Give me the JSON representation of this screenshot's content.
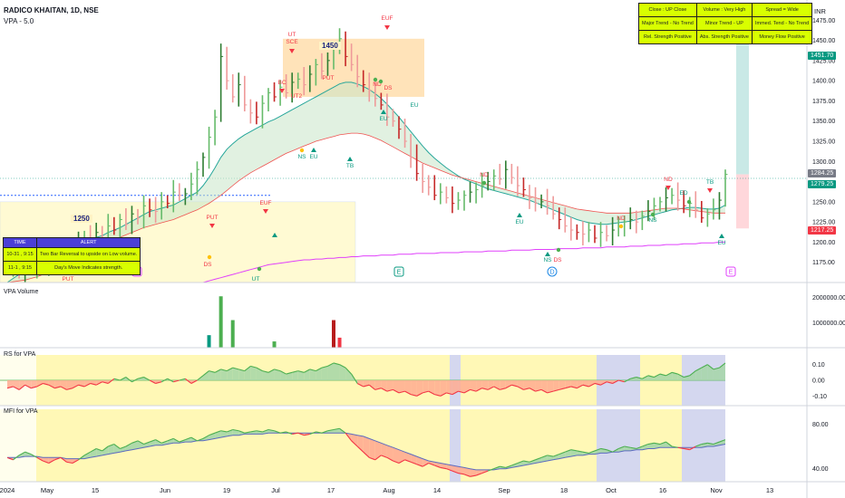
{
  "header": {
    "title": "RADICO KHAITAN, 1D, NSE",
    "indicator": "VPA - 5.0",
    "currency": "INR"
  },
  "trend_table": [
    [
      "Close : UP Close",
      "Volume : Very High",
      "Spread = Wide"
    ],
    [
      "Major Trend - No Trend",
      "Minor Trend - UP",
      "Immed. Tend - No Trend"
    ],
    [
      "Rel. Strength Positive",
      "Abs. Strength Positive",
      "Money Flow Positive"
    ]
  ],
  "alert_table": {
    "headers": [
      "TIME",
      "ALERT"
    ],
    "rows": [
      [
        "10-31 , 9:15",
        "Two Bar Reversal to upside on Low volume."
      ],
      [
        "11-1 , 9:15",
        "Day's Move Indicates strength."
      ]
    ]
  },
  "panes": {
    "volume": "VPA Volume",
    "rs": "RS for VPA",
    "mfi": "MFI for VPA"
  },
  "level_labels": [
    "1450",
    "1250"
  ],
  "price_tags": [
    {
      "value": "1451.70",
      "color": "#089981"
    },
    {
      "value": "1284.25",
      "color": "#787b86"
    },
    {
      "value": "1279.25",
      "color": "#089981"
    },
    {
      "value": "1217.25",
      "color": "#f23645"
    }
  ],
  "event_marks": [
    "E",
    "E",
    "D",
    "E"
  ],
  "annotations": [
    {
      "text": "EUF",
      "color": "#f23645"
    },
    {
      "text": "UT",
      "color": "#f23645"
    },
    {
      "text": "SCE",
      "color": "#f23645"
    },
    {
      "text": "BC",
      "color": "#f23645"
    },
    {
      "text": "UT2",
      "color": "#f23645"
    },
    {
      "text": "PUT",
      "color": "#f23645"
    },
    {
      "text": "ND",
      "color": "#f23645"
    },
    {
      "text": "DS",
      "color": "#f23645"
    },
    {
      "text": "EU",
      "color": "#089981"
    },
    {
      "text": "NS",
      "color": "#089981"
    },
    {
      "text": "EU",
      "color": "#089981"
    },
    {
      "text": "TB",
      "color": "#089981"
    },
    {
      "text": "EUF",
      "color": "#f23645"
    },
    {
      "text": "PUT",
      "color": "#f23645"
    },
    {
      "text": "DS",
      "color": "#f23645"
    },
    {
      "text": "UT",
      "color": "#089981"
    },
    {
      "text": "EU",
      "color": "#089981"
    },
    {
      "text": "ND",
      "color": "#f23645"
    },
    {
      "text": "EU",
      "color": "#089981"
    },
    {
      "text": "NS",
      "color": "#089981"
    },
    {
      "text": "DS",
      "color": "#f23645"
    },
    {
      "text": "ND",
      "color": "#f23645"
    },
    {
      "text": "NS",
      "color": "#089981"
    },
    {
      "text": "ND",
      "color": "#f23645"
    },
    {
      "text": "ED",
      "color": "#089981"
    },
    {
      "text": "TB",
      "color": "#089981"
    },
    {
      "text": "EU",
      "color": "#089981"
    },
    {
      "text": "PUT",
      "color": "#f23645"
    }
  ],
  "chart_data": [
    {
      "type": "candlestick",
      "title": "RADICO KHAITAN, 1D, NSE",
      "y_ticks": [
        1475,
        1450,
        1425,
        1400,
        1375,
        1350,
        1325,
        1300,
        1250,
        1225,
        1200,
        1175
      ],
      "y_tick_labels": [
        "1475.00",
        "1450.00",
        "1425.00",
        "1400.00",
        "1375.00",
        "1350.00",
        "1325.00",
        "1300.00",
        "1250.00",
        "1225.00",
        "1200.00",
        "1175.00"
      ],
      "ylim": [
        1150,
        1500
      ],
      "x_tick_labels": [
        "2024",
        "May",
        "15",
        "Jun",
        "19",
        "Jul",
        "17",
        "Aug",
        "14",
        "Sep",
        "18",
        "Oct",
        "16",
        "Nov",
        "13"
      ],
      "closes": [
        1168,
        1172,
        1162,
        1175,
        1168,
        1180,
        1172,
        1185,
        1190,
        1182,
        1195,
        1188,
        1200,
        1205,
        1198,
        1212,
        1205,
        1220,
        1215,
        1228,
        1222,
        1235,
        1230,
        1245,
        1240,
        1238,
        1250,
        1248,
        1262,
        1258,
        1260,
        1272,
        1290,
        1305,
        1330,
        1355,
        1430,
        1400,
        1380,
        1395,
        1370,
        1360,
        1355,
        1372,
        1385,
        1380,
        1392,
        1385,
        1398,
        1402,
        1395,
        1408,
        1420,
        1412,
        1425,
        1440,
        1452,
        1430,
        1420,
        1405,
        1395,
        1388,
        1378,
        1370,
        1355,
        1350,
        1340,
        1325,
        1305,
        1285,
        1275,
        1268,
        1258,
        1262,
        1255,
        1248,
        1252,
        1258,
        1262,
        1265,
        1270,
        1275,
        1282,
        1278,
        1290,
        1280,
        1270,
        1265,
        1255,
        1248,
        1250,
        1245,
        1235,
        1228,
        1220,
        1215,
        1212,
        1210,
        1215,
        1205,
        1212,
        1208,
        1215,
        1220,
        1225,
        1228,
        1225,
        1232,
        1238,
        1245,
        1250,
        1255,
        1258,
        1252,
        1245,
        1248,
        1240,
        1230,
        1235,
        1240,
        1252,
        1284
      ],
      "ema_fast": [
        1150,
        1155,
        1160,
        1165,
        1170,
        1172,
        1175,
        1180,
        1185,
        1188,
        1190,
        1193,
        1196,
        1200,
        1203,
        1206,
        1208,
        1212,
        1215,
        1218,
        1222,
        1226,
        1230,
        1234,
        1238,
        1240,
        1242,
        1244,
        1246,
        1250,
        1254,
        1258,
        1262,
        1270,
        1280,
        1292,
        1305,
        1315,
        1322,
        1328,
        1333,
        1337,
        1341,
        1345,
        1349,
        1352,
        1356,
        1360,
        1364,
        1368,
        1372,
        1376,
        1380,
        1384,
        1388,
        1392,
        1396,
        1398,
        1398,
        1396,
        1393,
        1389,
        1384,
        1378,
        1371,
        1363,
        1355,
        1346,
        1337,
        1328,
        1319,
        1311,
        1304,
        1298,
        1292,
        1287,
        1282,
        1278,
        1275,
        1272,
        1269,
        1266,
        1264,
        1262,
        1260,
        1258,
        1256,
        1254,
        1252,
        1249,
        1246,
        1243,
        1240,
        1237,
        1234,
        1231,
        1228,
        1226,
        1224,
        1223,
        1222,
        1222,
        1223,
        1224,
        1225,
        1226,
        1228,
        1230,
        1232,
        1234,
        1236,
        1238,
        1240,
        1241,
        1242,
        1243,
        1243,
        1242,
        1241,
        1241,
        1242,
        1246
      ],
      "ema_slow": [
        1150,
        1151,
        1152,
        1153,
        1155,
        1157,
        1160,
        1163,
        1166,
        1170,
        1174,
        1178,
        1182,
        1186,
        1190,
        1194,
        1197,
        1200,
        1203,
        1206,
        1209,
        1212,
        1215,
        1218,
        1220,
        1222,
        1224,
        1226,
        1228,
        1231,
        1234,
        1237,
        1240,
        1244,
        1248,
        1253,
        1258,
        1264,
        1270,
        1276,
        1281,
        1286,
        1290,
        1294,
        1298,
        1302,
        1306,
        1310,
        1313,
        1316,
        1319,
        1322,
        1325,
        1327,
        1329,
        1331,
        1333,
        1334,
        1335,
        1335,
        1334,
        1332,
        1329,
        1326,
        1322,
        1318,
        1314,
        1310,
        1306,
        1302,
        1298,
        1295,
        1292,
        1289,
        1286,
        1283,
        1281,
        1279,
        1277,
        1275,
        1273,
        1271,
        1269,
        1267,
        1265,
        1263,
        1261,
        1259,
        1257,
        1255,
        1253,
        1251,
        1249,
        1247,
        1245,
        1243,
        1241,
        1240,
        1239,
        1238,
        1237,
        1236,
        1236,
        1236,
        1236,
        1236,
        1237,
        1238,
        1239,
        1240,
        1241,
        1242,
        1242,
        1242,
        1241,
        1240,
        1239,
        1238,
        1237,
        1236,
        1236,
        1236
      ],
      "ema_long": [
        1150,
        1150,
        1150,
        1150,
        1150,
        1150,
        1150,
        1150,
        1150,
        1150,
        1150,
        1150,
        1150,
        1150,
        1150,
        1150,
        1150,
        1150,
        1150,
        1150,
        1150,
        1150,
        1150,
        1150,
        1150,
        1150,
        1150,
        1150,
        1150,
        1150,
        1150,
        1150,
        1150,
        1150,
        1152,
        1154,
        1156,
        1158,
        1160,
        1162,
        1164,
        1166,
        1168,
        1170,
        1172,
        1173,
        1174,
        1175,
        1176,
        1177,
        1178,
        1178,
        1179,
        1179,
        1180,
        1180,
        1181,
        1181,
        1182,
        1182,
        1183,
        1183,
        1183,
        1184,
        1184,
        1184,
        1185,
        1185,
        1185,
        1186,
        1186,
        1186,
        1186,
        1187,
        1187,
        1187,
        1187,
        1188,
        1188,
        1188,
        1188,
        1189,
        1189,
        1189,
        1189,
        1190,
        1190,
        1190,
        1190,
        1191,
        1191,
        1191,
        1191,
        1192,
        1192,
        1192,
        1192,
        1193,
        1193,
        1193,
        1193,
        1194,
        1194,
        1194,
        1194,
        1195,
        1195,
        1195,
        1196,
        1196,
        1196,
        1197,
        1197,
        1197,
        1198,
        1198,
        1198,
        1199,
        1199,
        1199,
        1200,
        1200
      ],
      "levels": [
        1450,
        1250
      ]
    },
    {
      "type": "bar",
      "title": "VPA Volume",
      "y_tick_labels": [
        "2000000.00",
        "1000000.00"
      ],
      "ylim": [
        0,
        2600000
      ],
      "spikes": [
        {
          "bar": 34,
          "value": 500000,
          "color": "#089981"
        },
        {
          "bar": 36,
          "value": 2050000,
          "color": "#4caf50"
        },
        {
          "bar": 38,
          "value": 1100000,
          "color": "#4caf50"
        },
        {
          "bar": 45,
          "value": 250000,
          "color": "#4caf50"
        },
        {
          "bar": 55,
          "value": 1100000,
          "color": "#b71c1c"
        },
        {
          "bar": 56,
          "value": 400000,
          "color": "#f23645"
        }
      ]
    },
    {
      "type": "area",
      "title": "RS for VPA",
      "y_tick_labels": [
        "0.10",
        "0.00",
        "-0.10"
      ],
      "ylim": [
        -0.15,
        0.15
      ],
      "values": [
        -0.05,
        -0.04,
        -0.06,
        -0.03,
        -0.05,
        -0.04,
        -0.02,
        -0.03,
        -0.05,
        -0.04,
        -0.06,
        -0.05,
        -0.03,
        -0.04,
        -0.02,
        -0.03,
        -0.01,
        -0.02,
        0.01,
        0.0,
        0.02,
        -0.01,
        0.01,
        0.02,
        0.0,
        -0.02,
        -0.01,
        0.01,
        -0.01,
        0.0,
        0.01,
        -0.02,
        0.0,
        0.03,
        0.06,
        0.05,
        0.07,
        0.06,
        0.08,
        0.07,
        0.06,
        0.09,
        0.08,
        0.06,
        0.05,
        0.07,
        0.06,
        0.04,
        0.05,
        0.06,
        0.05,
        0.07,
        0.06,
        0.08,
        0.09,
        0.11,
        0.1,
        0.08,
        0.04,
        -0.02,
        -0.04,
        -0.03,
        -0.06,
        -0.05,
        -0.07,
        -0.06,
        -0.08,
        -0.07,
        -0.09,
        -0.1,
        -0.08,
        -0.07,
        -0.09,
        -0.1,
        -0.08,
        -0.09,
        -0.07,
        -0.08,
        -0.06,
        -0.07,
        -0.05,
        -0.06,
        -0.04,
        -0.06,
        -0.05,
        -0.03,
        -0.04,
        -0.06,
        -0.05,
        -0.07,
        -0.06,
        -0.08,
        -0.07,
        -0.06,
        -0.05,
        -0.04,
        -0.05,
        -0.03,
        -0.04,
        -0.02,
        -0.03,
        -0.01,
        -0.02,
        0.0,
        -0.01,
        0.01,
        0.02,
        0.01,
        0.03,
        0.02,
        0.04,
        0.03,
        0.05,
        0.04,
        0.02,
        0.03,
        0.06,
        0.08,
        0.1,
        0.07,
        0.08,
        0.11
      ]
    },
    {
      "type": "line",
      "title": "MFI for VPA",
      "y_tick_labels": [
        "80.00",
        "40.00"
      ],
      "ylim": [
        30,
        90
      ],
      "mfi": [
        50,
        48,
        52,
        55,
        53,
        50,
        47,
        45,
        48,
        50,
        46,
        45,
        48,
        52,
        55,
        58,
        56,
        60,
        62,
        58,
        60,
        63,
        65,
        62,
        64,
        66,
        63,
        65,
        67,
        64,
        66,
        68,
        65,
        67,
        70,
        72,
        74,
        73,
        75,
        74,
        72,
        73,
        74,
        73,
        75,
        74,
        72,
        73,
        71,
        72,
        70,
        71,
        73,
        72,
        74,
        75,
        76,
        72,
        65,
        60,
        55,
        50,
        48,
        52,
        50,
        47,
        45,
        48,
        46,
        44,
        42,
        45,
        43,
        41,
        40,
        38,
        36,
        35,
        33,
        34,
        36,
        38,
        40,
        42,
        41,
        43,
        45,
        47,
        46,
        48,
        50,
        52,
        51,
        53,
        55,
        57,
        56,
        55,
        54,
        56,
        58,
        57,
        55,
        58,
        60,
        59,
        58,
        60,
        62,
        63,
        62,
        64,
        60,
        59,
        58,
        57,
        60,
        62,
        63,
        62,
        64,
        66
      ],
      "signal": [
        50,
        50,
        50,
        51,
        51,
        51,
        50,
        50,
        50,
        50,
        49,
        49,
        49,
        49,
        50,
        51,
        52,
        53,
        54,
        55,
        56,
        57,
        58,
        59,
        60,
        61,
        61,
        62,
        63,
        63,
        64,
        64,
        65,
        65,
        66,
        67,
        68,
        69,
        70,
        70,
        71,
        71,
        71,
        71,
        72,
        72,
        72,
        72,
        72,
        72,
        72,
        72,
        72,
        72,
        72,
        72,
        72,
        72,
        71,
        70,
        69,
        67,
        65,
        63,
        61,
        59,
        57,
        55,
        53,
        51,
        49,
        47,
        46,
        45,
        44,
        43,
        42,
        41,
        40,
        39,
        39,
        39,
        39,
        40,
        40,
        41,
        42,
        43,
        44,
        45,
        46,
        47,
        48,
        49,
        50,
        51,
        52,
        52,
        53,
        53,
        54,
        54,
        55,
        55,
        56,
        56,
        57,
        57,
        58,
        58,
        59,
        59,
        59,
        59,
        59,
        59,
        59,
        59,
        60,
        60,
        61,
        62
      ]
    }
  ]
}
